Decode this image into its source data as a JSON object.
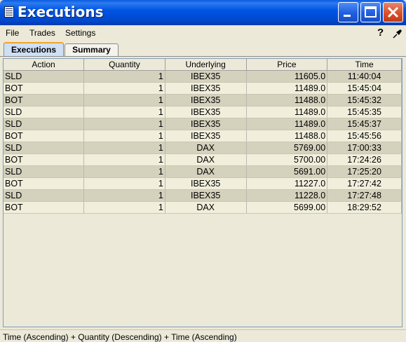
{
  "window": {
    "title": "Executions"
  },
  "menu": {
    "file": "File",
    "trades": "Trades",
    "settings": "Settings"
  },
  "tabs": [
    {
      "label": "Executions",
      "active": true
    },
    {
      "label": "Summary",
      "active": false
    }
  ],
  "table": {
    "columns": [
      "Action",
      "Quantity",
      "Underlying",
      "Price",
      "Time"
    ],
    "rows": [
      [
        "SLD",
        "1",
        "IBEX35",
        "11605.0",
        "11:40:04"
      ],
      [
        "BOT",
        "1",
        "IBEX35",
        "11489.0",
        "15:45:04"
      ],
      [
        "BOT",
        "1",
        "IBEX35",
        "11488.0",
        "15:45:32"
      ],
      [
        "SLD",
        "1",
        "IBEX35",
        "11489.0",
        "15:45:35"
      ],
      [
        "SLD",
        "1",
        "IBEX35",
        "11489.0",
        "15:45:37"
      ],
      [
        "BOT",
        "1",
        "IBEX35",
        "11488.0",
        "15:45:56"
      ],
      [
        "SLD",
        "1",
        "DAX",
        "5769.00",
        "17:00:33"
      ],
      [
        "BOT",
        "1",
        "DAX",
        "5700.00",
        "17:24:26"
      ],
      [
        "SLD",
        "1",
        "DAX",
        "5691.00",
        "17:25:20"
      ],
      [
        "BOT",
        "1",
        "IBEX35",
        "11227.0",
        "17:27:42"
      ],
      [
        "SLD",
        "1",
        "IBEX35",
        "11228.0",
        "17:27:48"
      ],
      [
        "BOT",
        "1",
        "DAX",
        "5699.00",
        "18:29:52"
      ]
    ]
  },
  "status": {
    "sort_text": "Time (Ascending)  +  Quantity (Descending)  +  Time (Ascending)"
  },
  "colors": {
    "title_bar": "#0055e5",
    "row_odd": "#d4d1bd",
    "row_even": "#f1efdc",
    "active_tab_accent": "#f2a32a"
  }
}
